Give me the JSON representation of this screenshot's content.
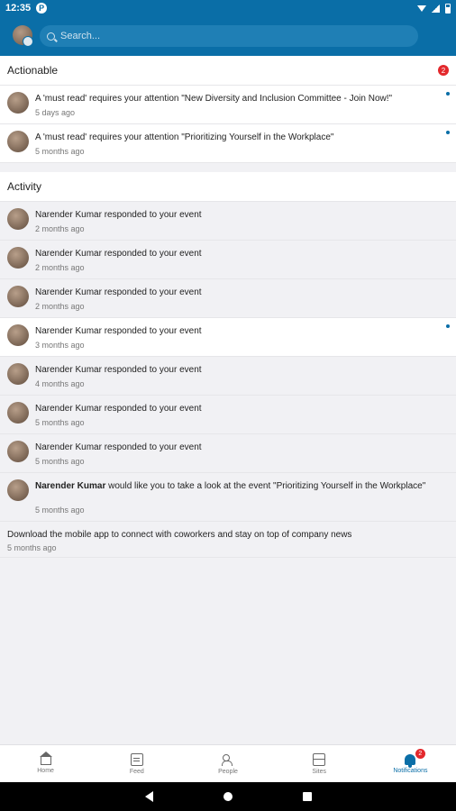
{
  "status_bar": {
    "time": "12:35",
    "app_badge": "P"
  },
  "search": {
    "placeholder": "Search..."
  },
  "actionable": {
    "title": "Actionable",
    "count": "2",
    "items": [
      {
        "text": "A 'must read' requires your attention \"New Diversity and Inclusion Committee - Join Now!\"",
        "time": "5 days ago"
      },
      {
        "text": "A 'must read' requires your attention \"Prioritizing Yourself in the Workplace\"",
        "time": "5 months ago"
      }
    ]
  },
  "activity": {
    "title": "Activity",
    "items": [
      {
        "text": "Narender Kumar responded to your event",
        "time": "2 months ago"
      },
      {
        "text": "Narender Kumar responded to your event",
        "time": "2 months ago"
      },
      {
        "text": "Narender Kumar responded to your event",
        "time": "2 months ago"
      },
      {
        "text": "Narender Kumar responded to your event",
        "time": "3 months ago"
      },
      {
        "text": "Narender Kumar responded to your event",
        "time": "4 months ago"
      },
      {
        "text": "Narender Kumar responded to your event",
        "time": "5 months ago"
      },
      {
        "text": "Narender Kumar responded to your event",
        "time": "5 months ago"
      },
      {
        "name": "Narender Kumar",
        "text": " would like you to take a look at the event \"Prioritizing Yourself in the Workplace\"",
        "time": "5 months ago"
      },
      {
        "text": "Download the mobile app to connect with coworkers and stay on top of company news",
        "time": "5 months ago"
      }
    ]
  },
  "bottom_nav": {
    "items": [
      {
        "label": "Home",
        "icon": "home-icon"
      },
      {
        "label": "Feed",
        "icon": "feed-icon"
      },
      {
        "label": "People",
        "icon": "people-icon"
      },
      {
        "label": "Sites",
        "icon": "sites-icon"
      },
      {
        "label": "Notifications",
        "icon": "bell-icon",
        "badge": "2"
      }
    ]
  },
  "colors": {
    "brand": "#0a6ea7",
    "unread_dot": "#0a6ea7",
    "badge": "#e3282c"
  }
}
